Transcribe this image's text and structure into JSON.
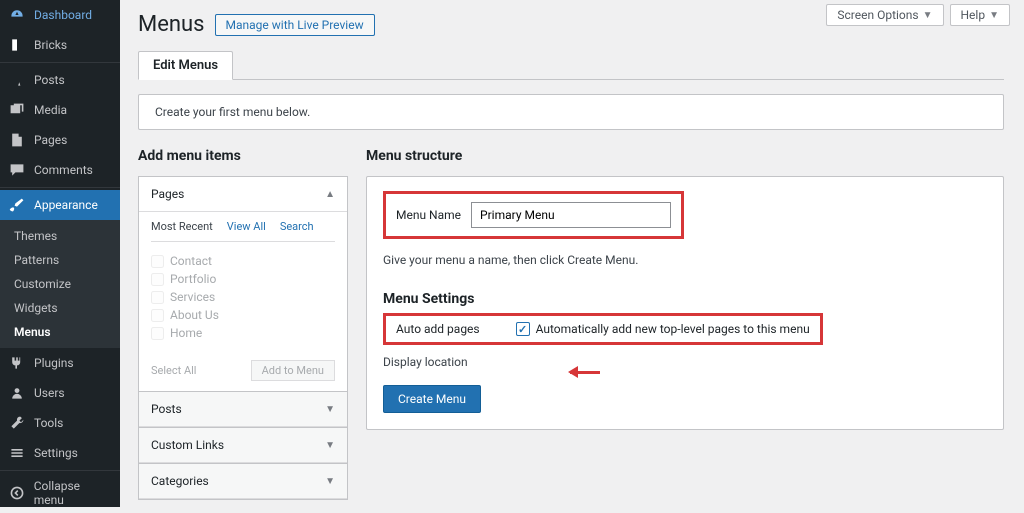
{
  "sidebar": {
    "items": [
      {
        "label": "Dashboard"
      },
      {
        "label": "Bricks"
      },
      {
        "label": "Posts"
      },
      {
        "label": "Media"
      },
      {
        "label": "Pages"
      },
      {
        "label": "Comments"
      },
      {
        "label": "Appearance"
      },
      {
        "label": "Plugins"
      },
      {
        "label": "Users"
      },
      {
        "label": "Tools"
      },
      {
        "label": "Settings"
      },
      {
        "label": "Collapse menu"
      }
    ],
    "sub": [
      {
        "label": "Themes"
      },
      {
        "label": "Patterns"
      },
      {
        "label": "Customize"
      },
      {
        "label": "Widgets"
      },
      {
        "label": "Menus"
      }
    ]
  },
  "topbar": {
    "screen_options": "Screen Options",
    "help": "Help"
  },
  "header": {
    "title": "Menus",
    "live_preview": "Manage with Live Preview",
    "tab": "Edit Menus"
  },
  "notice": "Create your first menu below.",
  "left_col": {
    "heading": "Add menu items",
    "pages_label": "Pages",
    "tabs": [
      "Most Recent",
      "View All",
      "Search"
    ],
    "items": [
      "Contact",
      "Portfolio",
      "Services",
      "About Us",
      "Home"
    ],
    "select_all": "Select All",
    "add_btn": "Add to Menu",
    "collapsed": [
      "Posts",
      "Custom Links",
      "Categories"
    ]
  },
  "right_col": {
    "heading": "Menu structure",
    "menu_name_label": "Menu Name",
    "menu_name_value": "Primary Menu",
    "hint": "Give your menu a name, then click Create Menu.",
    "settings_heading": "Menu Settings",
    "auto_add_label": "Auto add pages",
    "auto_add_text": "Automatically add new top-level pages to this menu",
    "display_location": "Display location",
    "create_btn": "Create Menu"
  }
}
